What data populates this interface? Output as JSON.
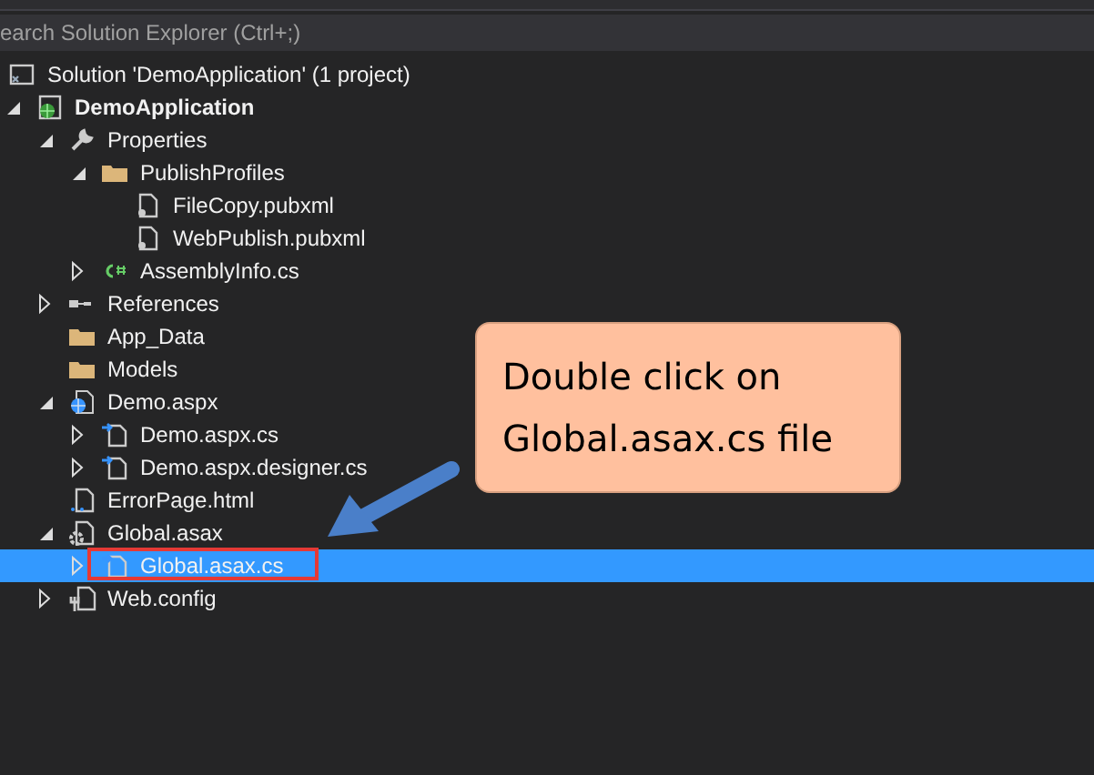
{
  "search": {
    "placeholder": "earch Solution Explorer (Ctrl+;)"
  },
  "tree": [
    {
      "label": "Solution 'DemoApplication' (1 project)",
      "kind": "solution",
      "selected": false,
      "children": [
        {
          "label": "DemoApplication",
          "kind": "project",
          "expanded": true,
          "selected": false,
          "children": [
            {
              "label": "Properties",
              "kind": "wrench",
              "expanded": true,
              "selected": false,
              "children": [
                {
                  "label": "PublishProfiles",
                  "kind": "folder",
                  "expanded": true,
                  "selected": false,
                  "children": [
                    {
                      "label": "FileCopy.pubxml",
                      "kind": "pubxml",
                      "selected": false
                    },
                    {
                      "label": "WebPublish.pubxml",
                      "kind": "pubxml",
                      "selected": false
                    }
                  ]
                },
                {
                  "label": "AssemblyInfo.cs",
                  "kind": "csharp",
                  "expanded": false,
                  "selected": false
                }
              ]
            },
            {
              "label": "References",
              "kind": "references",
              "expanded": false,
              "selected": false
            },
            {
              "label": "App_Data",
              "kind": "folder",
              "selected": false
            },
            {
              "label": "Models",
              "kind": "folder",
              "selected": false
            },
            {
              "label": "Demo.aspx",
              "kind": "web",
              "expanded": true,
              "selected": false,
              "children": [
                {
                  "label": "Demo.aspx.cs",
                  "kind": "cs",
                  "expanded": false,
                  "selected": false
                },
                {
                  "label": "Demo.aspx.designer.cs",
                  "kind": "cs",
                  "expanded": false,
                  "selected": false
                }
              ]
            },
            {
              "label": "ErrorPage.html",
              "kind": "html",
              "selected": false
            },
            {
              "label": "Global.asax",
              "kind": "gear",
              "expanded": true,
              "selected": false,
              "children": [
                {
                  "label": "Global.asax.cs",
                  "kind": "cs",
                  "expanded": false,
                  "selected": true
                }
              ]
            },
            {
              "label": "Web.config",
              "kind": "config",
              "expanded": false,
              "selected": false
            }
          ]
        }
      ]
    }
  ],
  "callout": {
    "lines": [
      "Double click on",
      "Global.asax.cs file"
    ]
  }
}
